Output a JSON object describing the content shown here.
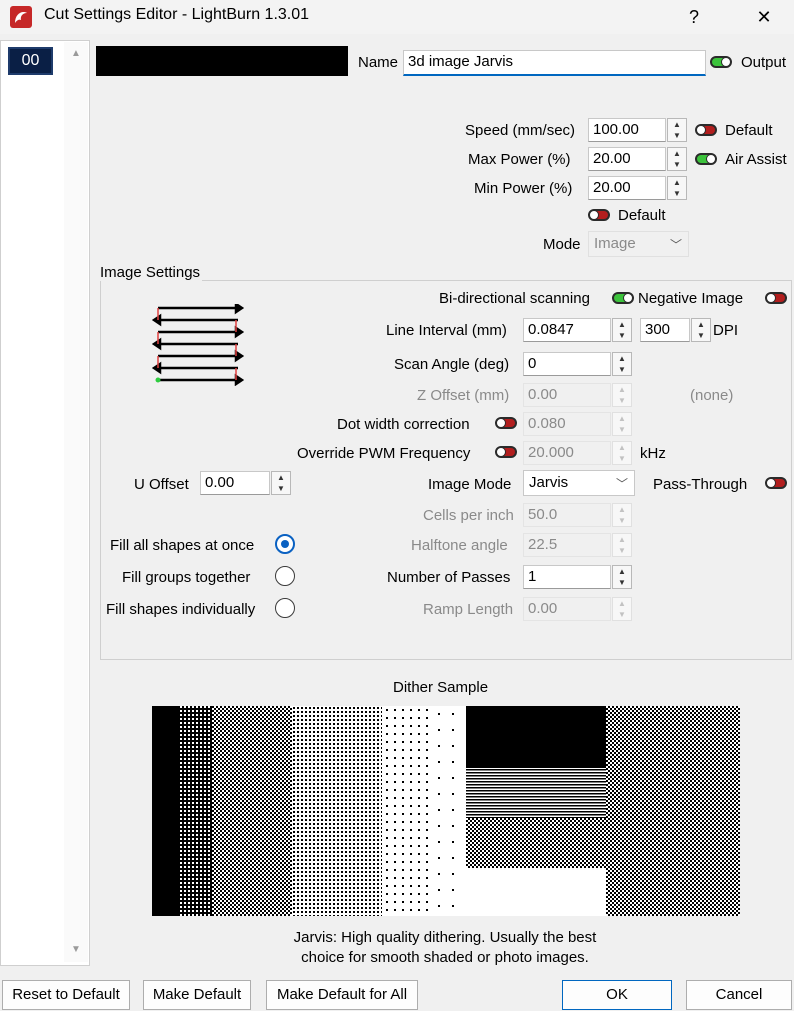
{
  "window": {
    "title": "Cut Settings Editor - LightBurn 1.3.01",
    "help_label": "?",
    "close_label": "✕"
  },
  "layers": {
    "selected": "00"
  },
  "layer": {
    "color": "#000000",
    "name_label": "Name",
    "name_value": "3d image Jarvis",
    "output_label": "Output",
    "output_on": true
  },
  "power": {
    "speed_label": "Speed (mm/sec)",
    "speed_value": "100.00",
    "speed_default_label": "Default",
    "max_power_label": "Max Power (%)",
    "max_power_value": "20.00",
    "air_assist_label": "Air Assist",
    "min_power_label": "Min Power (%)",
    "min_power_value": "20.00",
    "power_default_label": "Default",
    "mode_label": "Mode",
    "mode_value": "Image"
  },
  "image_settings": {
    "group_title": "Image Settings",
    "bidirectional_label": "Bi-directional scanning",
    "bidirectional_on": true,
    "negative_label": "Negative Image",
    "negative_on": false,
    "line_interval_label": "Line Interval (mm)",
    "line_interval_value": "0.0847",
    "dpi_value": "300",
    "dpi_label": "DPI",
    "scan_angle_label": "Scan Angle (deg)",
    "scan_angle_value": "0",
    "z_offset_label": "Z Offset (mm)",
    "z_offset_value": "0.00",
    "z_offset_note": "(none)",
    "dot_width_label": "Dot width correction",
    "dot_width_value": "0.080",
    "pwm_label": "Override PWM Frequency",
    "pwm_value": "20.000",
    "pwm_unit": "kHz",
    "u_offset_label": "U Offset",
    "u_offset_value": "0.00",
    "image_mode_label": "Image Mode",
    "image_mode_value": "Jarvis",
    "pass_through_label": "Pass-Through",
    "cells_label": "Cells per inch",
    "cells_value": "50.0",
    "halftone_label": "Halftone angle",
    "halftone_value": "22.5",
    "passes_label": "Number of Passes",
    "passes_value": "1",
    "ramp_label": "Ramp Length",
    "ramp_value": "0.00",
    "fill_options": [
      {
        "label": "Fill all shapes at once",
        "selected": true
      },
      {
        "label": "Fill groups together",
        "selected": false
      },
      {
        "label": "Fill shapes individually",
        "selected": false
      }
    ]
  },
  "dither": {
    "title": "Dither Sample",
    "caption_line1": "Jarvis: High quality dithering. Usually the best",
    "caption_line2": "choice for smooth shaded or photo images."
  },
  "footer": {
    "reset": "Reset to Default",
    "make_default": "Make Default",
    "make_default_all": "Make Default for All",
    "ok": "OK",
    "cancel": "Cancel"
  },
  "icons": {
    "app": "lightburn-logo-icon",
    "spin": "spin-updown-icon",
    "scan": "scan-lines-icon"
  },
  "colors": {
    "toggle_on": "#3cc33c",
    "toggle_off": "#b21e1e",
    "accent": "#0067c0"
  }
}
